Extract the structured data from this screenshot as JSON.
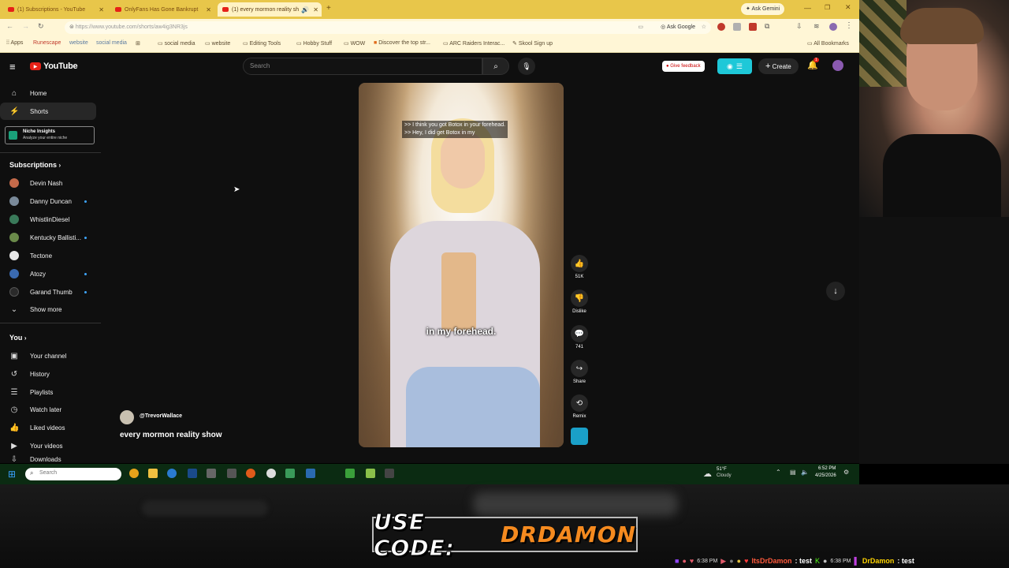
{
  "tabs": [
    {
      "label": "(1) Subscriptions - YouTube"
    },
    {
      "label": "OnlyFans Has Gone Bankrupt"
    },
    {
      "label": "(1) every mormon reality sh"
    }
  ],
  "ask_gemini": "Ask Gemini",
  "url": "https://www.youtube.com/shorts/aw4ig3NR3js",
  "ask_google": "Ask Google",
  "bookmarks": [
    "Apps",
    "Runescape",
    "website",
    "social media",
    "social media",
    "website",
    "Editing Tools",
    "Hobby Stuff",
    "WOW",
    "Discover the top str...",
    "ARC Raiders Interac...",
    "Skool Sign up",
    "All Bookmarks"
  ],
  "youtube": {
    "logo": "YouTube",
    "search_placeholder": "Search",
    "give_feedback": "Give feedback",
    "create": "Create",
    "notif_count": "1"
  },
  "sidebar": {
    "home": "Home",
    "shorts": "Shorts",
    "niche_title": "Niche Insights",
    "niche_sub": "Analyze your entire niche",
    "subscriptions": "Subscriptions",
    "subs": [
      {
        "name": "Devin Nash",
        "dot": false,
        "color": "#c46a4a"
      },
      {
        "name": "Danny Duncan",
        "dot": true,
        "color": "#7a8a9a"
      },
      {
        "name": "WhistlinDiesel",
        "dot": false,
        "color": "#3a7a5a"
      },
      {
        "name": "Kentucky Ballisti...",
        "dot": true,
        "color": "#6a8a4a"
      },
      {
        "name": "Tectone",
        "dot": false,
        "color": "#e8e8e8"
      },
      {
        "name": "Atozy",
        "dot": true,
        "color": "#3a6ab0"
      },
      {
        "name": "Garand Thumb",
        "dot": true,
        "color": "#2a2a2a"
      }
    ],
    "show_more": "Show more",
    "you": "You",
    "you_items": [
      "Your channel",
      "History",
      "Playlists",
      "Watch later",
      "Liked videos",
      "Your videos",
      "Downloads"
    ]
  },
  "short": {
    "caption_top_1": ">> I think you got Botox in your forehead.",
    "caption_top_2": ">> Hey, I did get Botox in my",
    "caption_mid": "in my forehead.",
    "channel": "@TrevorWallace",
    "title": "every mormon reality show",
    "likes": "51K",
    "dislike": "Dislike",
    "comments": "741",
    "share": "Share",
    "remix": "Remix"
  },
  "taskbar": {
    "search": "Search",
    "weather_temp": "51°F",
    "weather_desc": "Cloudy",
    "time": "6:52 PM",
    "date": "4/25/2026"
  },
  "stream": {
    "promo": "USE CODE: DRDAMON",
    "promo_prefix": "USE CODE:",
    "promo_code": "DRDAMON",
    "chat1_time": "6:38 PM",
    "chat1_user": "ItsDrDamon",
    "chat1_msg": ": test",
    "chat2_time": "6:38 PM",
    "chat2_user": "DrDamon",
    "chat2_msg": ": test"
  },
  "colors": {
    "accent_red": "#e62117",
    "tab_yellow": "#e8c64a",
    "yt_bg": "#0f0f0f",
    "promo_orange": "#f58a1f",
    "chat_name": "#ff5a3c",
    "chat_name2": "#ffd400"
  }
}
